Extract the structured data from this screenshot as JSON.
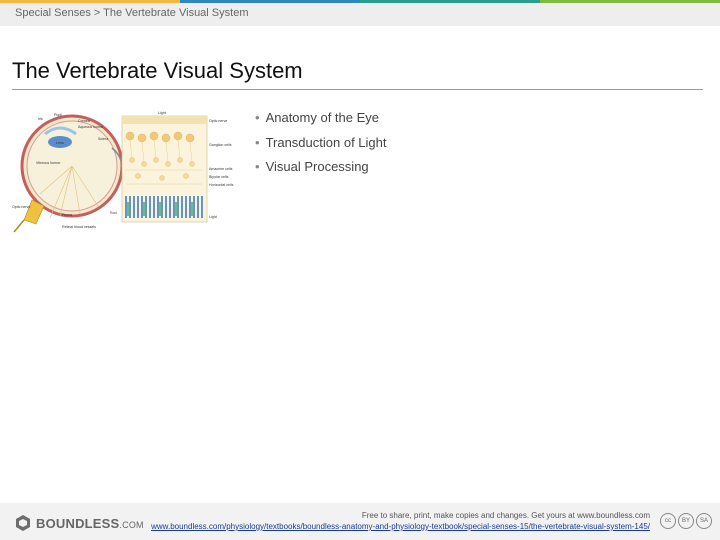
{
  "header": {
    "breadcrumb": "Special Senses > The Vertebrate Visual System",
    "stripe_colors": [
      "#f4b73f",
      "#2e86c1",
      "#2a9d8f",
      "#7dbb42"
    ]
  },
  "slide": {
    "title": "The Vertebrate Visual System",
    "bullets": [
      "Anatomy of the Eye",
      "Transduction of Light",
      "Visual Processing"
    ]
  },
  "figure": {
    "eye_labels": {
      "iris": "Iris",
      "pupil": "Pupil",
      "cornea": "Cornea",
      "aqueous": "Aqueous humor",
      "lens": "Lens",
      "sclera": "Sclera",
      "vitreous": "Vitreous humor",
      "optic_nerve": "Optic nerve",
      "fovea": "Fovea",
      "retinal_blood": "Retinal blood vessels"
    },
    "retina_labels": {
      "light_top": "Light",
      "optic_nerve": "Optic nerve",
      "ganglion": "Ganglion cells",
      "amacrine": "Amacrine cells",
      "bipolar": "Bipolar cells",
      "horizontal": "Horizontal cells",
      "rod": "Rod",
      "cone": "Light"
    }
  },
  "footer": {
    "logo_main": "BOUNDLESS",
    "logo_suffix": ".COM",
    "note": "Free to share, print, make copies and changes. Get yours at www.boundless.com",
    "link": "www.boundless.com/physiology/textbooks/boundless-anatomy-and-physiology-textbook/special-senses-15/the-vertebrate-visual-system-145/",
    "license_badges": [
      "cc",
      "BY",
      "SA"
    ],
    "license_labels": "BY   SA"
  }
}
